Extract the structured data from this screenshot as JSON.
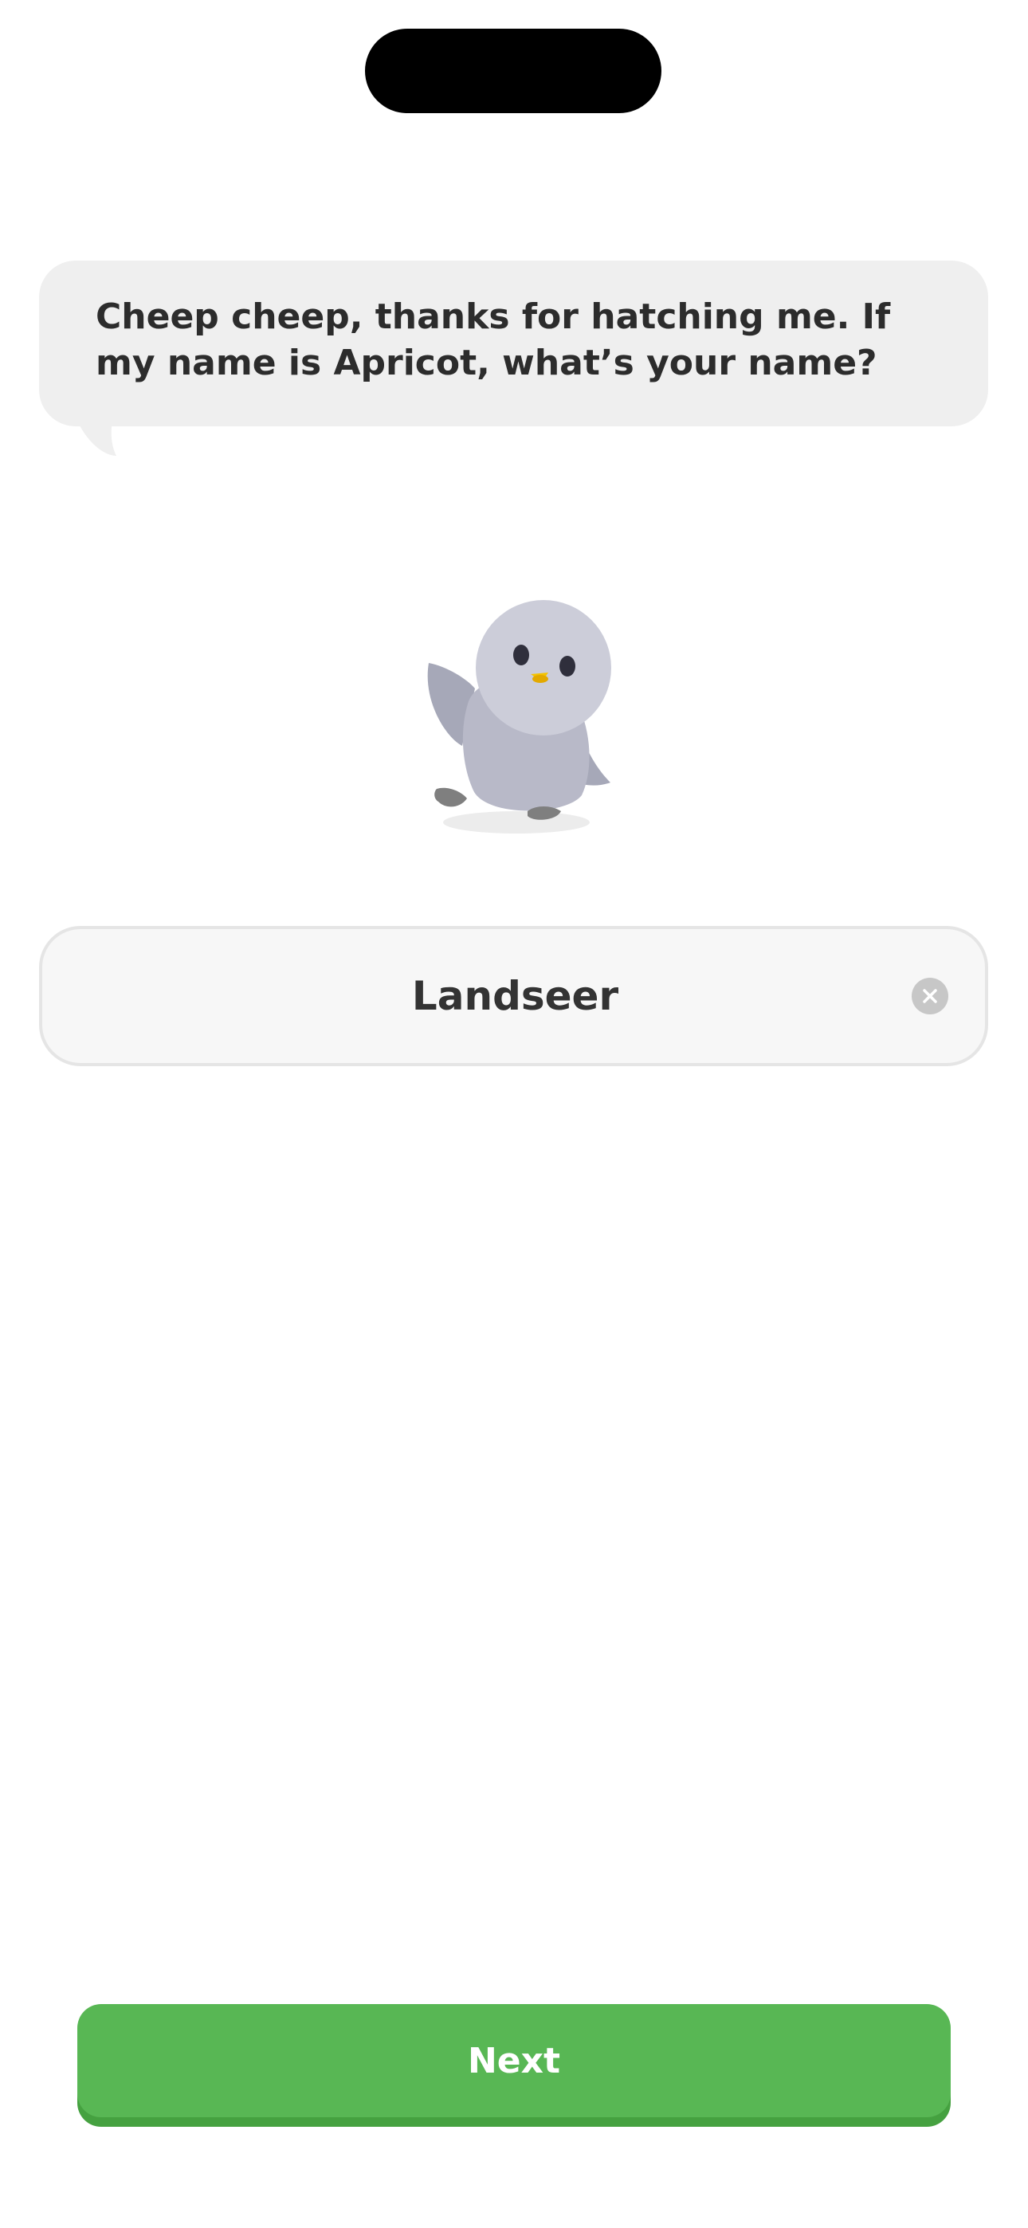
{
  "prompt": {
    "text": "Cheep cheep, thanks for hatching me. If my name is Apricot, what’s your name?"
  },
  "mascot": {
    "icon": "bird-mascot-icon",
    "colors": {
      "body": "#b8b9c8",
      "head": "#cccdd9",
      "beak": "#f4c300",
      "feet": "#7f7f7f"
    }
  },
  "name_field": {
    "value": "Landseer",
    "clear_icon": "clear-icon"
  },
  "actions": {
    "next_label": "Next"
  },
  "colors": {
    "accent": "#58b754",
    "accent_shadow": "#45a140",
    "bubble": "#efefef"
  }
}
